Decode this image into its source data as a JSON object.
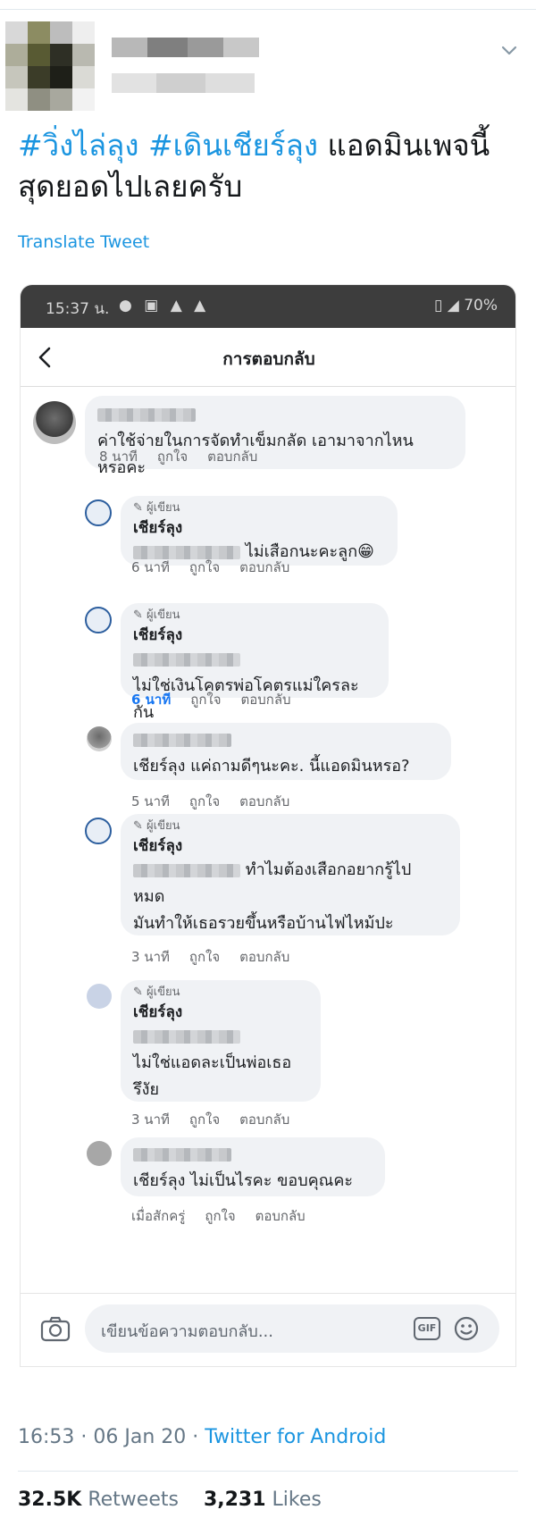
{
  "tweet": {
    "text_parts": [
      "#วิ่งไล่ลุง",
      "#เดินเชียร์ลุง",
      "แอดมินเพจนี้",
      "สุดยอดไปเลยครับ"
    ],
    "translate_label": "Translate Tweet",
    "timestamp": "16:53 · 06 Jan 20",
    "source": "Twitter for Android",
    "retweets_count": "32.5K",
    "retweets_label": "Retweets",
    "likes_count": "3,231",
    "likes_label": "Likes"
  },
  "phone": {
    "status_time": "15:37 น.",
    "status_battery": "70%",
    "header_title": "การตอบกลับ",
    "author_badge": "ผู้เขียน",
    "page_name": "เชียร์ลุง",
    "like_label": "ถูกใจ",
    "reply_label": "ตอบกลับ",
    "comments": [
      {
        "text_line1": "ค่าใช้จ่ายในการจัดทำเข็มกลัด  เอามาจากไหน",
        "text_line2": "หรอคะ",
        "time": "8 นาที"
      },
      {
        "text": "ไม่เสือกนะคะลูก😁",
        "time": "6 นาที"
      },
      {
        "text": "ไม่ใช่เงินโคตรพ่อโคตรแม่ใครละกัน",
        "time": "6 นาที"
      },
      {
        "text": "เชียร์ลุง แค่ถามดีๆนะคะ. นี้แอดมินหรอ?",
        "time": "5 นาที"
      },
      {
        "text_line1": "ทำไมต้องเสือกอยากรู้ไป",
        "text_line2": "หมด",
        "text_line3": "มันทำให้เธอรวยขึ้นหรือบ้านไฟไหม้ปะ",
        "time": "3 นาที"
      },
      {
        "text_line1": "ไม่ใช่แอดละเป็นพ่อเธอ",
        "text_line2": "รึงัย",
        "time": "3 นาที"
      },
      {
        "text": "เชียร์ลุง ไม่เป็นไรคะ ขอบคุณคะ",
        "time": "เมื่อสักครู่"
      }
    ],
    "composer_placeholder": "เขียนข้อความตอบกลับ...",
    "gif_label": "GIF"
  }
}
